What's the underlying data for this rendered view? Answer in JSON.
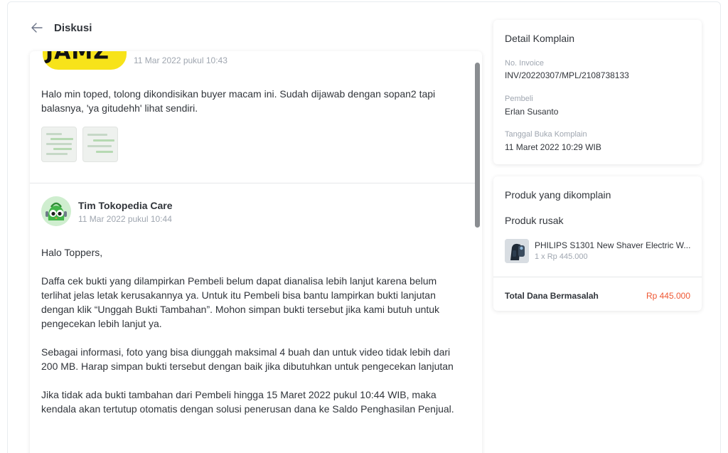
{
  "header": {
    "title": "Diskusi",
    "back_icon": "arrow-left-icon"
  },
  "discussion": {
    "posts": [
      {
        "logo_text": "JAMZ",
        "timestamp": "11 Mar 2022 pukul 10:43",
        "body": "Halo min toped, tolong dikondisikan buyer macam ini. Sudah dijawab dengan sopan2 tapi balasnya, 'ya gitudehh' lihat sendiri.",
        "attachment_count": 2
      },
      {
        "author": "Tim Tokopedia Care",
        "timestamp": "11 Mar 2022 pukul 10:44",
        "paragraphs": [
          "Halo Toppers,",
          "Daffa cek bukti yang dilampirkan Pembeli belum dapat dianalisa lebih lanjut karena belum terlihat jelas letak kerusakannya ya. Untuk itu Pembeli bisa bantu lampirkan bukti lanjutan dengan klik “Unggah Bukti Tambahan”. Mohon simpan bukti tersebut jika kami butuh untuk pengecekan lebih lanjut ya.",
          "Sebagai informasi, foto yang bisa diunggah maksimal 4 buah dan untuk video tidak lebih dari 200 MB. Harap simpan bukti tersebut dengan baik jika dibutuhkan untuk pengecekan lanjutan",
          "Jika tidak ada bukti tambahan dari Pembeli hingga 15 Maret 2022 pukul 10:44 WIB, maka kendala akan tertutup otomatis dengan solusi penerusan dana ke Saldo Penghasilan Penjual."
        ]
      }
    ]
  },
  "detail": {
    "title": "Detail Komplain",
    "invoice_label": "No. Invoice",
    "invoice_value": "INV/20220307/MPL/2108738133",
    "buyer_label": "Pembeli",
    "buyer_value": "Erlan Susanto",
    "opened_label": "Tanggal Buka Komplain",
    "opened_value": "11 Maret 2022 10:29 WIB"
  },
  "product": {
    "title": "Produk yang dikomplain",
    "issue": "Produk rusak",
    "name": "PHILIPS S1301 New Shaver Electric W...",
    "qty_price": "1 x Rp 445.000",
    "total_label": "Total Dana Bermasalah",
    "total_value": "Rp 445.000"
  },
  "colors": {
    "accent_price": "#ef5733",
    "text_primary": "#31353b",
    "text_muted": "#9fa6b0"
  }
}
